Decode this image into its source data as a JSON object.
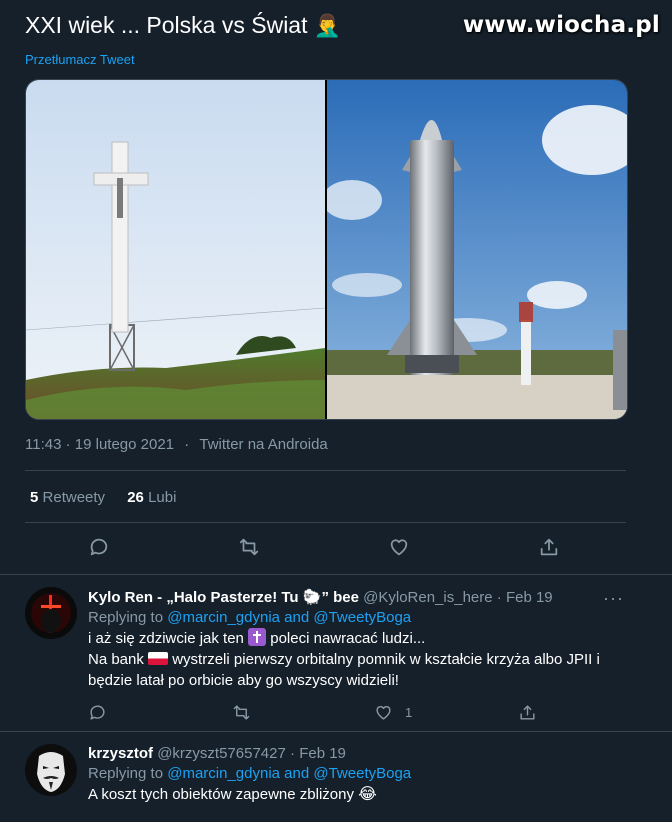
{
  "watermark": "www.wiocha.pl",
  "tweet": {
    "title": "XXI wiek ... Polska vs Świat",
    "title_emoji": "🤦‍♂️",
    "translate": "Przetłumacz Tweet",
    "time": "11:43 · 19 lutego 2021",
    "dot": "·",
    "source": "Twitter na Androida",
    "retweets_count": "5",
    "retweets_label": "Retweety",
    "likes_count": "26",
    "likes_label": "Lubi",
    "media": {
      "left_image": "cross-on-hill-image",
      "right_image": "starship-rocket-image"
    }
  },
  "replies": [
    {
      "name": "Kylo Ren - „Halo Pasterze! Tu",
      "name_emoji": "🐑",
      "name_suffix": "” bee",
      "handle": "@KyloRen_is_here",
      "sep": "·",
      "date": "Feb 19",
      "more": "···",
      "replying_to": "Replying to",
      "mention_1": "@marcin_gdynia",
      "and": "and",
      "mention_2": "@TweetyBoga",
      "line1_a": "i aż się zdziwcie jak ten",
      "line1_b": "poleci nawracać ludzi...",
      "line2_a": "Na bank",
      "line2_b": "wystrzeli pierwszy orbitalny pomnik w kształcie krzyża albo JPII i",
      "line3": "będzie latał po orbicie aby go wszyscy widzieli!",
      "likes": "1"
    },
    {
      "name": "krzysztof",
      "handle": "@krzyszt57657427",
      "sep": "·",
      "date": "Feb 19",
      "replying_to": "Replying to",
      "mention_1": "@marcin_gdynia",
      "and": "and",
      "mention_2": "@TweetyBoga",
      "text": "A koszt tych obiektów zapewne zbliżony",
      "text_emoji": "😂"
    }
  ],
  "colors": {
    "background": "#15202b",
    "link": "#1da1f2",
    "muted": "#8899a6",
    "border": "#38444d"
  }
}
